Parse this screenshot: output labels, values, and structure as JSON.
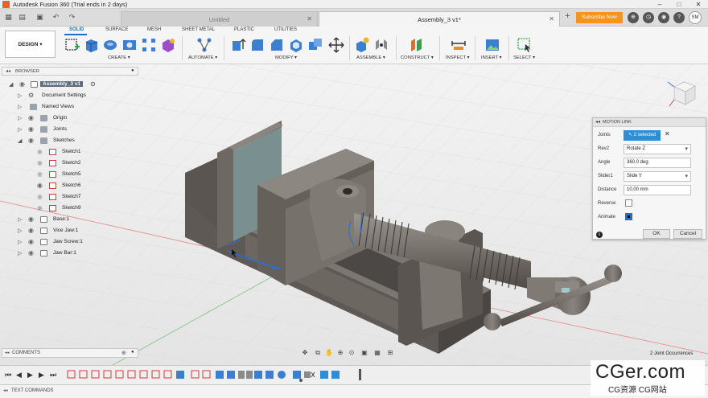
{
  "window": {
    "title": "Autodesk Fusion 360 (Trial ends in 2 days)"
  },
  "tabs": [
    {
      "label": "Untitled",
      "active": false
    },
    {
      "label": "Assembly_3 v1*",
      "active": true
    }
  ],
  "subscribe_label": "Subscribe Now",
  "user_initials": "SM",
  "workspace_label": "DESIGN",
  "ribbon_tabs": [
    "SOLID",
    "SURFACE",
    "MESH",
    "SHEET METAL",
    "PLASTIC",
    "UTILITIES"
  ],
  "ribbon_groups": [
    "CREATE",
    "AUTOMATE",
    "MODIFY",
    "ASSEMBLE",
    "CONSTRUCT",
    "INSPECT",
    "INSERT",
    "SELECT"
  ],
  "browser": {
    "title": "BROWSER",
    "root": "Assembly_3 v1",
    "items": [
      "Document Settings",
      "Named Views",
      "Origin",
      "Joints",
      "Sketches",
      "Sketch1",
      "Sketch2",
      "Sketch5",
      "Sketch6",
      "Sketch7",
      "Sketch9",
      "Base:1",
      "Vice Jaw:1",
      "Jaw Screw:1",
      "Jaw Bar:1"
    ]
  },
  "dialog": {
    "title": "MOTION LINK",
    "joints_label": "Joints",
    "joints_value": "2 selected",
    "rev_label": "Rev2",
    "rev_value": "Rotate Z",
    "angle_label": "Angle",
    "angle_value": "360.0 deg",
    "slider_label": "Slider1",
    "slider_value": "Slide Y",
    "distance_label": "Distance",
    "distance_value": "10.00 mm",
    "reverse_label": "Reverse",
    "reverse_checked": false,
    "animate_label": "Animate",
    "animate_checked": true,
    "ok_label": "OK",
    "cancel_label": "Cancel"
  },
  "comments_label": "COMMENTS",
  "occurrences_text": "2 Joint Occurrences",
  "text_commands_label": "TEXT COMMANDS",
  "watermark": {
    "main": "CGer.com",
    "sub": "CG资源 CG网站"
  },
  "colors": {
    "accent": "#1f6fc4",
    "subscribe": "#f7941d",
    "selected": "#2c8fd6"
  }
}
